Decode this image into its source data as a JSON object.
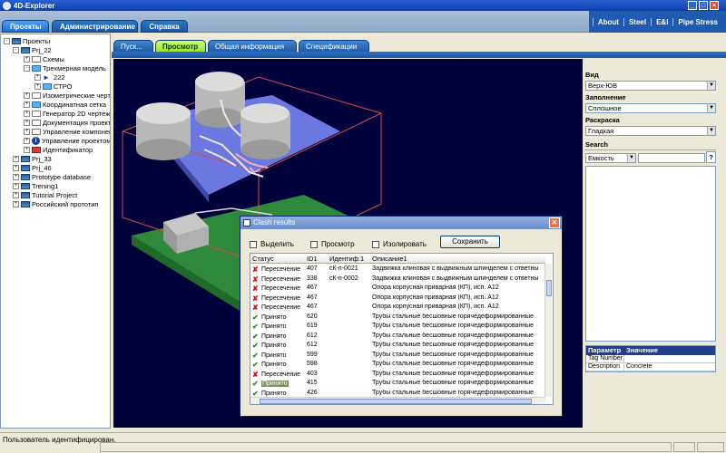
{
  "window": {
    "title": "4D-Explorer"
  },
  "menu_tabs": [
    {
      "label": "Проекты",
      "active": true
    },
    {
      "label": "Администрирование",
      "active": false
    },
    {
      "label": "Справка",
      "active": false
    }
  ],
  "top_links": [
    "About",
    "Steel",
    "E&I",
    "Pipe Stress"
  ],
  "tree": {
    "nodes": [
      {
        "label": "Проекты",
        "exp": "-",
        "icon": "proj"
      },
      {
        "label": "Prj_22",
        "exp": "-",
        "icon": "proj"
      },
      {
        "label": "Схемы",
        "exp": "+",
        "icon": "doc"
      },
      {
        "label": "Трехмерная модель",
        "exp": "-",
        "icon": "cube"
      },
      {
        "label": "222",
        "exp": "+",
        "icon": "arrow"
      },
      {
        "label": "СТРО",
        "exp": "+",
        "icon": "cube"
      },
      {
        "label": "Изометрические черте",
        "exp": "+",
        "icon": "doc"
      },
      {
        "label": "Координатная сетка",
        "exp": "+",
        "icon": "cube"
      },
      {
        "label": "Генератор 2D чертеж",
        "exp": "+",
        "icon": "doc"
      },
      {
        "label": "Документация проект",
        "exp": "+",
        "icon": "doc"
      },
      {
        "label": "Управление компонен",
        "exp": "+",
        "icon": "doc"
      },
      {
        "label": "Управление проектом",
        "exp": "+",
        "icon": "info"
      },
      {
        "label": "Идентификатор",
        "exp": "+",
        "icon": "red"
      },
      {
        "label": "Prj_33",
        "exp": "+",
        "icon": "proj"
      },
      {
        "label": "Prj_46",
        "exp": "+",
        "icon": "proj"
      },
      {
        "label": "Prototype database",
        "exp": "+",
        "icon": "proj"
      },
      {
        "label": "Trening1",
        "exp": "+",
        "icon": "proj"
      },
      {
        "label": "Tutorial Project",
        "exp": "+",
        "icon": "proj"
      },
      {
        "label": "Российский прототип",
        "exp": "+",
        "icon": "proj"
      }
    ]
  },
  "sub_tabs": [
    {
      "label": "Пуск...",
      "active": false
    },
    {
      "label": "Просмотр",
      "active": true
    },
    {
      "label": "Общая информация",
      "active": false
    },
    {
      "label": "Спецификации",
      "active": false
    }
  ],
  "right_panel": {
    "view_label": "Вид",
    "view_value": "Верх-ЮВ",
    "fill_label": "Заполнение",
    "fill_value": "Сплошное",
    "color_label": "Раскраска",
    "color_value": "Гладкая",
    "search_label": "Search",
    "search_field": "Емкость",
    "search_button": "?",
    "params_header_name": "Параметр",
    "params_header_value": "Значение",
    "params": [
      {
        "name": "Tag Number",
        "value": ""
      },
      {
        "name": "Description",
        "value": "Concrete"
      }
    ]
  },
  "status": {
    "text": "Пользователь идентифицирован."
  },
  "dialog": {
    "title": "Clash results",
    "close": "✕",
    "checkboxes": [
      "Выделить",
      "Просмотр",
      "Изолировать"
    ],
    "save_button": "Сохранить",
    "columns": [
      "Статус",
      "ID1",
      "Идентиф.1",
      "Описание1"
    ],
    "rows": [
      {
        "status": "Пересечение",
        "mark": "x",
        "id": "407",
        "ident": "сК-п-0021",
        "desc": "Задвижка клиновая с выдвижным шпинделем с ответны"
      },
      {
        "status": "Пересечение",
        "mark": "x",
        "id": "338",
        "ident": "сК-п-0002",
        "desc": "Задвижка клиновая с выдвижным шпинделем с ответны"
      },
      {
        "status": "Пересечение",
        "mark": "x",
        "id": "467",
        "ident": "",
        "desc": "Опора корпусная приварная (КП), исп. А12"
      },
      {
        "status": "Пересечение",
        "mark": "x",
        "id": "467",
        "ident": "",
        "desc": "Опора корпусная приварная (КП), исп. А12"
      },
      {
        "status": "Пересечение",
        "mark": "x",
        "id": "467",
        "ident": "",
        "desc": "Опора корпусная приварная (КП), исп. А12"
      },
      {
        "status": "Принято",
        "mark": "ok",
        "id": "620",
        "ident": "",
        "desc": "Трубы стальные бесшовные горячедеформированные"
      },
      {
        "status": "Принято",
        "mark": "ok",
        "id": "619",
        "ident": "",
        "desc": "Трубы стальные бесшовные горячедеформированные"
      },
      {
        "status": "Принято",
        "mark": "ok",
        "id": "612",
        "ident": "",
        "desc": "Трубы стальные бесшовные горячедеформированные"
      },
      {
        "status": "Принято",
        "mark": "ok",
        "id": "612",
        "ident": "",
        "desc": "Трубы стальные бесшовные горячедеформированные"
      },
      {
        "status": "Принято",
        "mark": "ok",
        "id": "599",
        "ident": "",
        "desc": "Трубы стальные бесшовные горячедеформированные"
      },
      {
        "status": "Принято",
        "mark": "ok",
        "id": "598",
        "ident": "",
        "desc": "Трубы стальные бесшовные горячедеформированные"
      },
      {
        "status": "Пересечение",
        "mark": "x",
        "id": "403",
        "ident": "",
        "desc": "Трубы стальные бесшовные горячедеформированные"
      },
      {
        "status": "Принято",
        "mark": "ok",
        "id": "415",
        "ident": "",
        "desc": "Трубы стальные бесшовные горячедеформированные",
        "selected": true
      },
      {
        "status": "Принято",
        "mark": "ok",
        "id": "426",
        "ident": "",
        "desc": "Трубы стальные бесшовные горячедеформированные"
      }
    ]
  }
}
